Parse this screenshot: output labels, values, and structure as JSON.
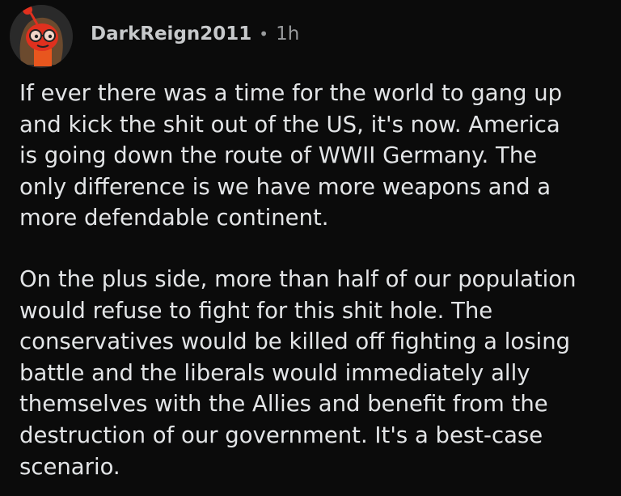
{
  "comment": {
    "username": "DarkReign2011",
    "separator": "•",
    "age": "1h",
    "avatar_icon": "snoo-avatar-icon",
    "paragraphs": [
      {
        "lines": [
          "If ever there was a time for the world to gang up",
          "and kick the shit out of the US, it's now. America",
          "is going down the route of WWII Germany. The",
          "only difference is we have more weapons and a",
          "more defendable continent."
        ]
      },
      {
        "lines": [
          "On the plus side, more than half of our population",
          "would refuse to fight for this shit hole. The",
          "conservatives would be killed off fighting a losing",
          "battle and the liberals would immediately ally",
          "themselves with the Allies and benefit from the",
          "destruction of our government. It's a best-case",
          "scenario."
        ]
      }
    ]
  },
  "colors": {
    "background": "#0b0b0b",
    "text": "#e3e5e7",
    "meta": "#9a9c9e",
    "avatar_accent": "#e0301e"
  }
}
